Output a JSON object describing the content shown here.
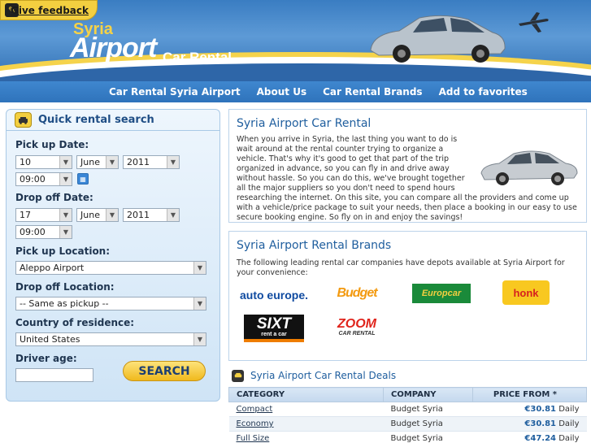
{
  "header": {
    "feedback_label": "Give feedback",
    "logo_line1": "Syria",
    "logo_line2": "Airport",
    "logo_line3": "Car Rental"
  },
  "nav": {
    "items": [
      "Car Rental Syria Airport",
      "About Us",
      "Car Rental Brands",
      "Add to favorites"
    ]
  },
  "search": {
    "title": "Quick rental search",
    "pickup_date_label": "Pick up Date:",
    "pickup_day": "10",
    "pickup_month": "June",
    "pickup_year": "2011",
    "pickup_time": "09:00",
    "dropoff_date_label": "Drop off Date:",
    "dropoff_day": "17",
    "dropoff_month": "June",
    "dropoff_year": "2011",
    "dropoff_time": "09:00",
    "pickup_location_label": "Pick up Location:",
    "pickup_location": "Aleppo Airport",
    "dropoff_location_label": "Drop off Location:",
    "dropoff_location": "-- Same as pickup --",
    "residence_label": "Country of residence:",
    "residence": "United States",
    "age_label": "Driver age:",
    "age_value": "",
    "search_button": "SEARCH"
  },
  "intro": {
    "title": "Syria Airport Car Rental",
    "text1": "When you arrive in Syria, the last thing you want to do is wait around at the rental counter trying to organize a vehicle. That's why it's good to get that part of the trip organized in advance, so you can fly in and drive away without hassle. So you can do this, we've brought together all the major suppliers so you don't need to spend hours",
    "text2": "researching the internet. On this site, you can compare all the providers and come up with a vehicle/price package to suit your needs, then place a booking in our easy to use secure booking engine. So fly on in and enjoy the savings!"
  },
  "brands": {
    "title": "Syria Airport Rental Brands",
    "text": "The following leading rental car companies have depots available at Syria Airport for your convenience:",
    "logos": {
      "autoeurope": "auto europe.",
      "budget": "Budget",
      "europcar": "Europcar",
      "honk": "honk",
      "sixt_main": "SIXT",
      "sixt_sub": "rent a car",
      "zoom_main": "ZOOM",
      "zoom_sub": "CAR RENTAL"
    }
  },
  "deals": {
    "title": "Syria Airport Car Rental Deals",
    "columns": [
      "CATEGORY",
      "COMPANY",
      "PRICE FROM *"
    ],
    "rows": [
      {
        "category": "Compact",
        "company": "Budget Syria",
        "price": "€30.81",
        "period": "Daily"
      },
      {
        "category": "Economy",
        "company": "Budget Syria",
        "price": "€30.81",
        "period": "Daily"
      },
      {
        "category": "Full Size",
        "company": "Budget Syria",
        "price": "€47.24",
        "period": "Daily"
      }
    ]
  },
  "colors": {
    "brand_blue": "#2f73bb",
    "brand_yellow": "#f3cf40",
    "link_blue": "#1f5e9e"
  }
}
